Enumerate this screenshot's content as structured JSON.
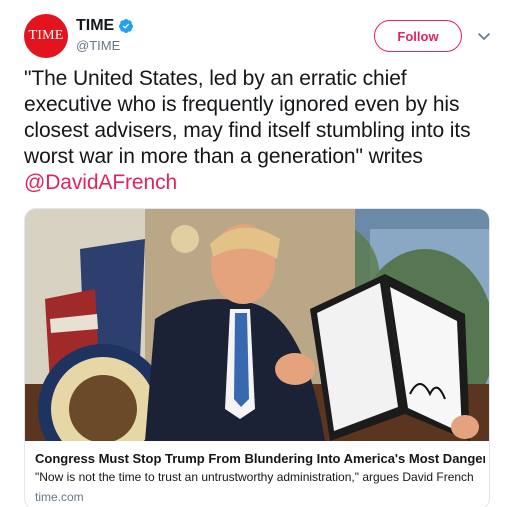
{
  "author": {
    "avatar_text": "TIME",
    "display_name": "TIME",
    "handle": "@TIME",
    "verified": true
  },
  "follow_label": "Follow",
  "tweet": {
    "text": "\"The United States, led by an erratic chief executive who is frequently ignored even by his closest advisers, may find itself stumbling into its worst war in more than a generation\" writes ",
    "mention": "@DavidAFrench"
  },
  "card": {
    "title": "Congress Must Stop Trump From Blundering Into America's Most Danger...",
    "description": "\"Now is not the time to trust an untrustworthy administration,\" argues David French",
    "domain": "time.com"
  },
  "colors": {
    "accent": "#e0245e",
    "brand_red": "#e4141f",
    "verified_blue": "#1da1f2",
    "secondary_text": "#657786"
  },
  "icons": {
    "verified": "verified-badge-icon",
    "caret": "chevron-down-icon"
  }
}
